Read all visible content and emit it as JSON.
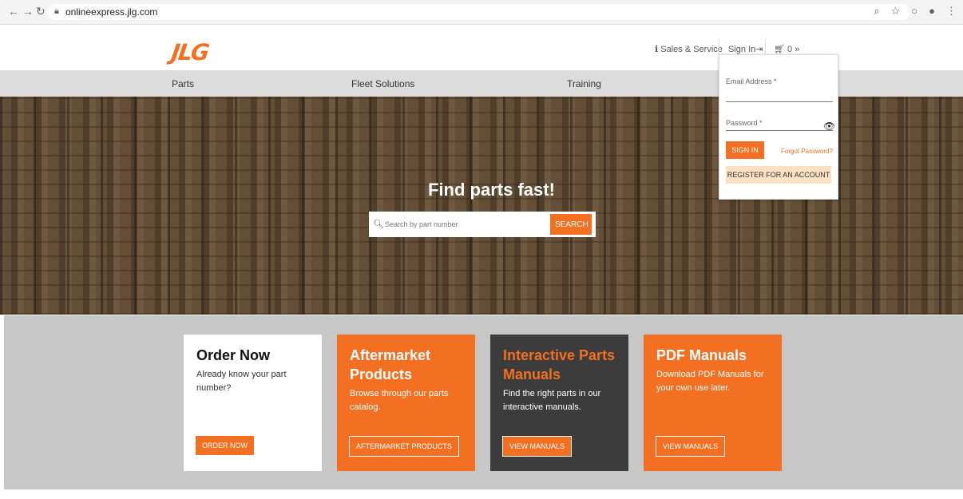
{
  "browser": {
    "url": "onlineexpress.jlg.com",
    "icons": [
      "back-arrow",
      "forward-arrow",
      "reload",
      "lock",
      "zoom",
      "star",
      "extension",
      "profile",
      "menu"
    ]
  },
  "header": {
    "logo": "JLG",
    "sales_service": "Sales & Service",
    "sign_in": "Sign In",
    "cart_count": "0",
    "cart_more": "»"
  },
  "nav": {
    "items": [
      "Parts",
      "Fleet Solutions",
      "Training"
    ]
  },
  "hero": {
    "title": "Find parts fast!",
    "search_placeholder": "Search by part number",
    "search_button": "SEARCH"
  },
  "cards": [
    {
      "title": "Order Now",
      "text": "Already know your part number?",
      "button": "ORDER NOW"
    },
    {
      "title": "Aftermarket Products",
      "text": "Browse through our parts catalog.",
      "button": "AFTERMARKET PRODUCTS"
    },
    {
      "title": "Interactive Parts Manuals",
      "text": "Find the right parts in our interactive manuals.",
      "button": "VIEW MANUALS"
    },
    {
      "title": "PDF Manuals",
      "text": "Download PDF Manuals for your own use later.",
      "button": "VIEW MANUALS"
    }
  ],
  "signin_dropdown": {
    "email_label": "Email Address *",
    "password_label": "Password *",
    "signin_button": "SIGN IN",
    "forgot": "Forgot Password?",
    "register": "REGISTER FOR AN ACCOUNT"
  },
  "colors": {
    "accent": "#f36f21",
    "dark_card": "#3c3c3c",
    "section_bg": "#c7c7c7",
    "nav_bg": "#dcdcdc"
  }
}
